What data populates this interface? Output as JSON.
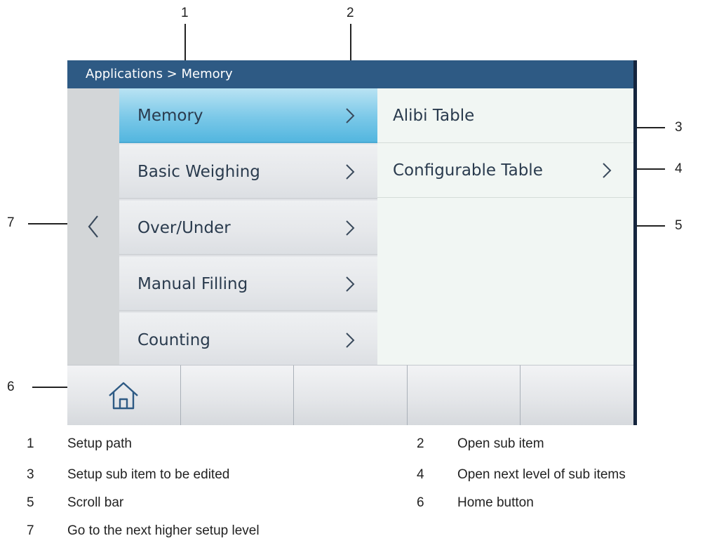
{
  "screen": {
    "path": "Applications > Memory",
    "menu_items": [
      {
        "label": "Memory",
        "active": true
      },
      {
        "label": "Basic Weighing",
        "active": false
      },
      {
        "label": "Over/Under",
        "active": false
      },
      {
        "label": "Manual Filling",
        "active": false
      },
      {
        "label": "Counting",
        "active": false
      }
    ],
    "sub_items": [
      {
        "label": "Alibi Table",
        "has_arrow": false
      },
      {
        "label": "Configurable Table",
        "has_arrow": true
      }
    ],
    "scroll_fraction": 0.53,
    "icons": {
      "back": "chevron-left-icon",
      "home": "home-icon",
      "open": "chevron-right-icon"
    },
    "colors": {
      "path_bar": "#2e5a84",
      "active_item": "#7ac8e8",
      "scroll_thumb": "#2e5a84",
      "frame": "#15253e"
    }
  },
  "callouts": {
    "n1": "1",
    "n2": "2",
    "n3": "3",
    "n4": "4",
    "n5": "5",
    "n6": "6",
    "n7": "7"
  },
  "legend": [
    {
      "num": "1",
      "text": "Setup path"
    },
    {
      "num": "2",
      "text": "Open sub item"
    },
    {
      "num": "3",
      "text": "Setup sub item to be edited"
    },
    {
      "num": "4",
      "text": "Open next level of sub items"
    },
    {
      "num": "5",
      "text": "Scroll bar"
    },
    {
      "num": "6",
      "text": "Home button"
    },
    {
      "num": "7",
      "text": "Go to the next higher setup level"
    }
  ]
}
